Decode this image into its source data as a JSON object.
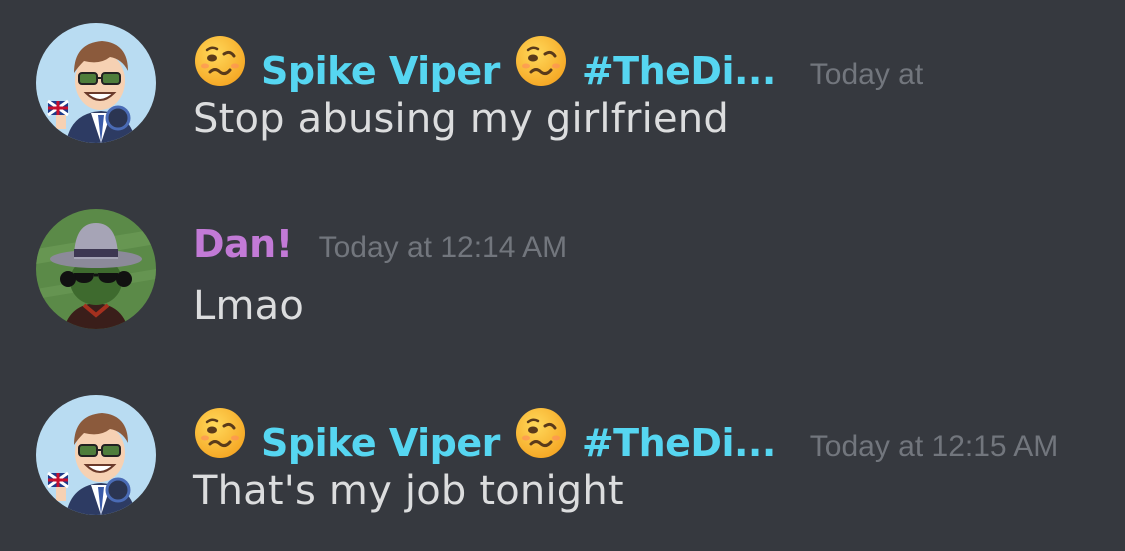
{
  "messages": [
    {
      "author": "Spike Viper",
      "channel_tag": "#TheDi...",
      "emoji": "woozy-face",
      "timestamp": "Today at",
      "text": "Stop abusing my girlfriend",
      "name_color": "#56d6f1"
    },
    {
      "author": "Dan!",
      "timestamp": "Today at 12:14 AM",
      "text": "Lmao",
      "name_color": "#c27ad6"
    },
    {
      "author": "Spike Viper",
      "channel_tag": "#TheDi...",
      "emoji": "woozy-face",
      "timestamp": "Today at 12:15 AM",
      "text": "That's my job tonight",
      "name_color": "#56d6f1"
    }
  ],
  "colors": {
    "background": "#36393f",
    "message_text": "#dcddde",
    "timestamp": "#72767d"
  }
}
